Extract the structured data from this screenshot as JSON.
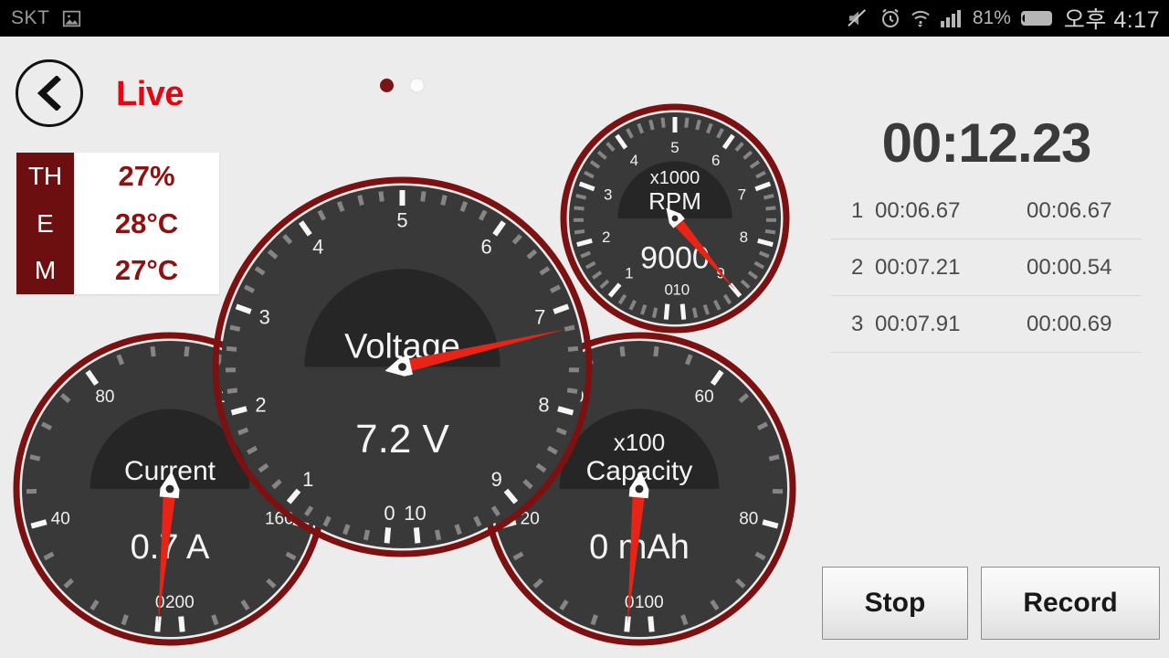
{
  "statusbar": {
    "carrier": "SKT",
    "battery_percent": "81%",
    "clock": "오후 4:17",
    "icons": [
      "image-icon",
      "mute-icon",
      "alarm-icon",
      "wifi-icon",
      "signal-icon",
      "battery-icon"
    ]
  },
  "header": {
    "title": "Live",
    "back_icon": "chevron-left-icon",
    "dots": [
      {
        "state": "active"
      },
      {
        "state": "inactive"
      }
    ]
  },
  "them_panel": {
    "rows": [
      {
        "label": "TH",
        "value": "27%"
      },
      {
        "label": "E",
        "value": "28°C"
      },
      {
        "label": "M",
        "value": "27°C"
      }
    ]
  },
  "gauges": [
    {
      "id": "voltage",
      "title": "Voltage",
      "multiplier": "",
      "value_text": "7.2 V",
      "unit": "V",
      "value": 7.2,
      "min": 0,
      "max": 10,
      "tick_labels": [
        "0",
        "1",
        "2",
        "3",
        "4",
        "5",
        "6",
        "7",
        "8",
        "9",
        "10"
      ]
    },
    {
      "id": "rpm",
      "title": "RPM",
      "multiplier": "x1000",
      "value_text": "9000",
      "unit": "RPM",
      "value": 9,
      "min": 0,
      "max": 10,
      "tick_labels": [
        "0",
        "1",
        "2",
        "3",
        "4",
        "5",
        "6",
        "7",
        "8",
        "9",
        "10"
      ]
    },
    {
      "id": "current",
      "title": "Current",
      "multiplier": "",
      "value_text": "0.7 A",
      "unit": "A",
      "value": 0,
      "min": 0,
      "max": 200,
      "tick_labels": [
        "0",
        "40",
        "80",
        "120",
        "160",
        "200"
      ]
    },
    {
      "id": "capacity",
      "title": "Capacity",
      "multiplier": "x100",
      "value_text": "0 mAh",
      "unit": "mAh",
      "value": 0,
      "min": 0,
      "max": 100,
      "tick_labels": [
        "0",
        "20",
        "40",
        "60",
        "80",
        "100"
      ]
    }
  ],
  "timer": {
    "elapsed": "00:12.23"
  },
  "laps": [
    {
      "index": "1",
      "total": "00:06.67",
      "split": "00:06.67"
    },
    {
      "index": "2",
      "total": "00:07.21",
      "split": "00:00.54"
    },
    {
      "index": "3",
      "total": "00:07.91",
      "split": "00:00.69"
    }
  ],
  "buttons": {
    "stop": "Stop",
    "record": "Record"
  },
  "colors": {
    "accent_red": "#e30613",
    "dark_red": "#6d0f10",
    "needle": "#e82416",
    "gauge_face": "#3a3a3a",
    "background": "#ececec"
  }
}
